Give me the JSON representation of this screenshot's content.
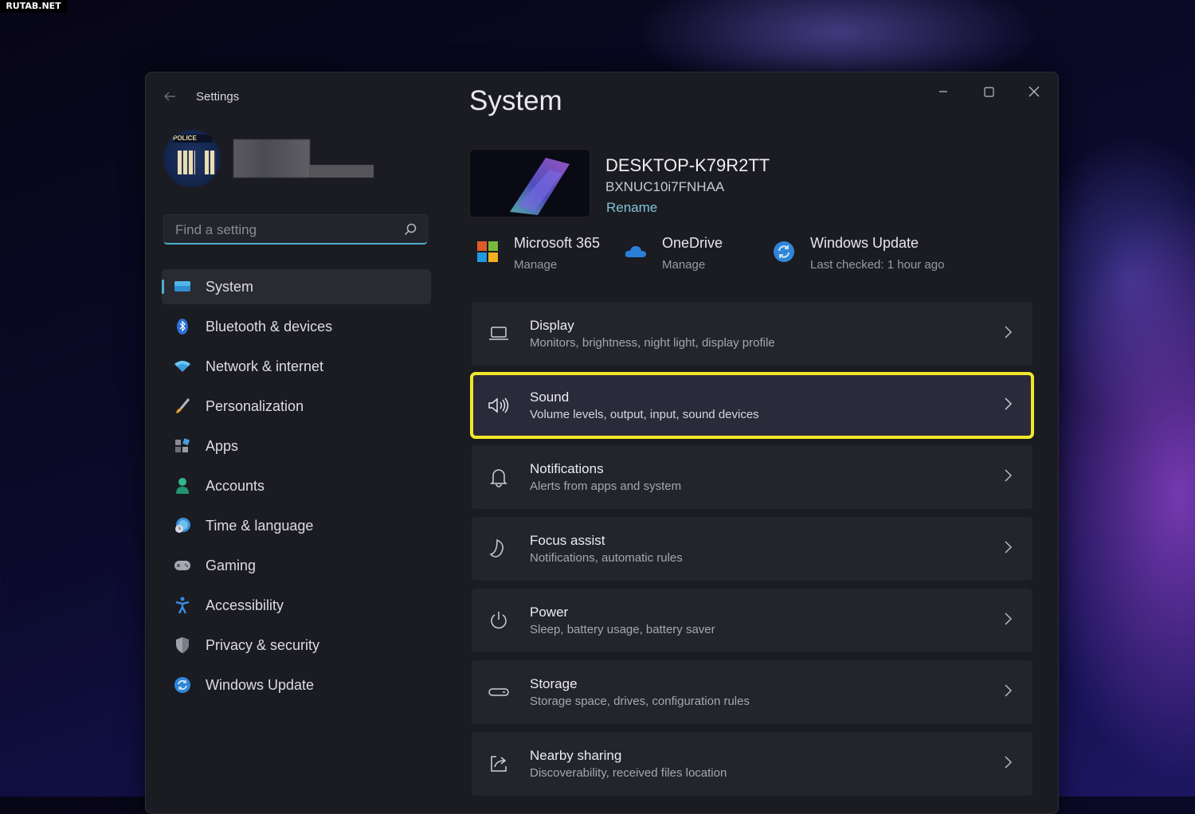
{
  "watermark": "RUTAB.NET",
  "window": {
    "title": "Settings",
    "controls": {
      "minimize": "minimize",
      "maximize": "maximize",
      "close": "close"
    }
  },
  "profile": {
    "avatar_badge": "POLICE",
    "username": "(blurred)"
  },
  "search": {
    "placeholder": "Find a setting",
    "value": ""
  },
  "sidebar": {
    "items": [
      {
        "label": "System",
        "icon": "monitor-icon",
        "active": true
      },
      {
        "label": "Bluetooth & devices",
        "icon": "bluetooth-icon"
      },
      {
        "label": "Network & internet",
        "icon": "wifi-icon"
      },
      {
        "label": "Personalization",
        "icon": "brush-icon"
      },
      {
        "label": "Apps",
        "icon": "apps-icon"
      },
      {
        "label": "Accounts",
        "icon": "person-icon"
      },
      {
        "label": "Time & language",
        "icon": "globe-clock-icon"
      },
      {
        "label": "Gaming",
        "icon": "gamepad-icon"
      },
      {
        "label": "Accessibility",
        "icon": "accessibility-icon"
      },
      {
        "label": "Privacy & security",
        "icon": "shield-icon"
      },
      {
        "label": "Windows Update",
        "icon": "update-icon"
      }
    ]
  },
  "main": {
    "title": "System",
    "device": {
      "name": "DESKTOP-K79R2TT",
      "model": "BXNUC10i7FNHAA",
      "rename_label": "Rename"
    },
    "quick_links": [
      {
        "title": "Microsoft 365",
        "subtitle": "Manage",
        "icon": "microsoft-logo-icon"
      },
      {
        "title": "OneDrive",
        "subtitle": "Manage",
        "icon": "cloud-icon"
      },
      {
        "title": "Windows Update",
        "subtitle": "Last checked: 1 hour ago",
        "icon": "update-icon"
      }
    ],
    "cards": [
      {
        "title": "Display",
        "subtitle": "Monitors, brightness, night light, display profile",
        "icon": "laptop-icon"
      },
      {
        "title": "Sound",
        "subtitle": "Volume levels, output, input, sound devices",
        "icon": "speaker-icon",
        "highlighted": true
      },
      {
        "title": "Notifications",
        "subtitle": "Alerts from apps and system",
        "icon": "bell-icon"
      },
      {
        "title": "Focus assist",
        "subtitle": "Notifications, automatic rules",
        "icon": "moon-icon"
      },
      {
        "title": "Power",
        "subtitle": "Sleep, battery usage, battery saver",
        "icon": "power-icon"
      },
      {
        "title": "Storage",
        "subtitle": "Storage space, drives, configuration rules",
        "icon": "storage-icon"
      },
      {
        "title": "Nearby sharing",
        "subtitle": "Discoverability, received files location",
        "icon": "share-icon"
      }
    ]
  },
  "colors": {
    "accent": "#4fb1c9",
    "highlight": "#f3e62a",
    "window_bg": "#1b1b22",
    "card_bg": "#24242d"
  }
}
